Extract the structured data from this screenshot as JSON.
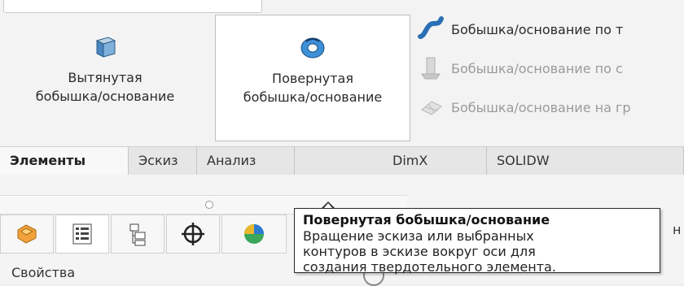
{
  "ribbon": {
    "extrude_label": "Вытянутая\nбобышка/основание",
    "extrude_line1": "Вытянутая",
    "extrude_line2": "бобышка/основание",
    "revolve_line1": "Повернутая",
    "revolve_line2": "бобышка/основание",
    "sweep_label": "Бобышка/основание по т",
    "loft_label": "Бобышка/основание по с",
    "boundary_label": "Бобышка/основание на гр"
  },
  "tabs": [
    {
      "label": "Элементы",
      "active": true
    },
    {
      "label": "Эскиз"
    },
    {
      "label": "Анализ"
    },
    {
      "label": "DimX"
    },
    {
      "label": "SOLIDW"
    }
  ],
  "tooltip": {
    "title": "Повернутая бобышка/основание",
    "body": "Вращение эскиза или выбранных\nконтуров в эскизе вокруг оси для\nсоздания твердотельного элемента."
  },
  "manager": {
    "bottom_text": "Свойства",
    "side_text": "н"
  },
  "icons": {
    "extrude": "extrude-icon",
    "revolve": "revolve-icon",
    "sweep": "sweep-icon",
    "loft": "loft-icon",
    "boundary": "boundary-icon",
    "feature_manager": "feature-manager-icon",
    "property_manager": "property-manager-icon",
    "configuration_manager": "configuration-manager-icon",
    "dimxpert": "dimxpert-icon",
    "display_manager": "display-manager-icon"
  },
  "colors": {
    "tooltip_border": "#2a2a2a",
    "disabled_text": "#9a9a9a",
    "accent_blue": "#1f6fb2",
    "icon_orange": "#f2a23a"
  }
}
